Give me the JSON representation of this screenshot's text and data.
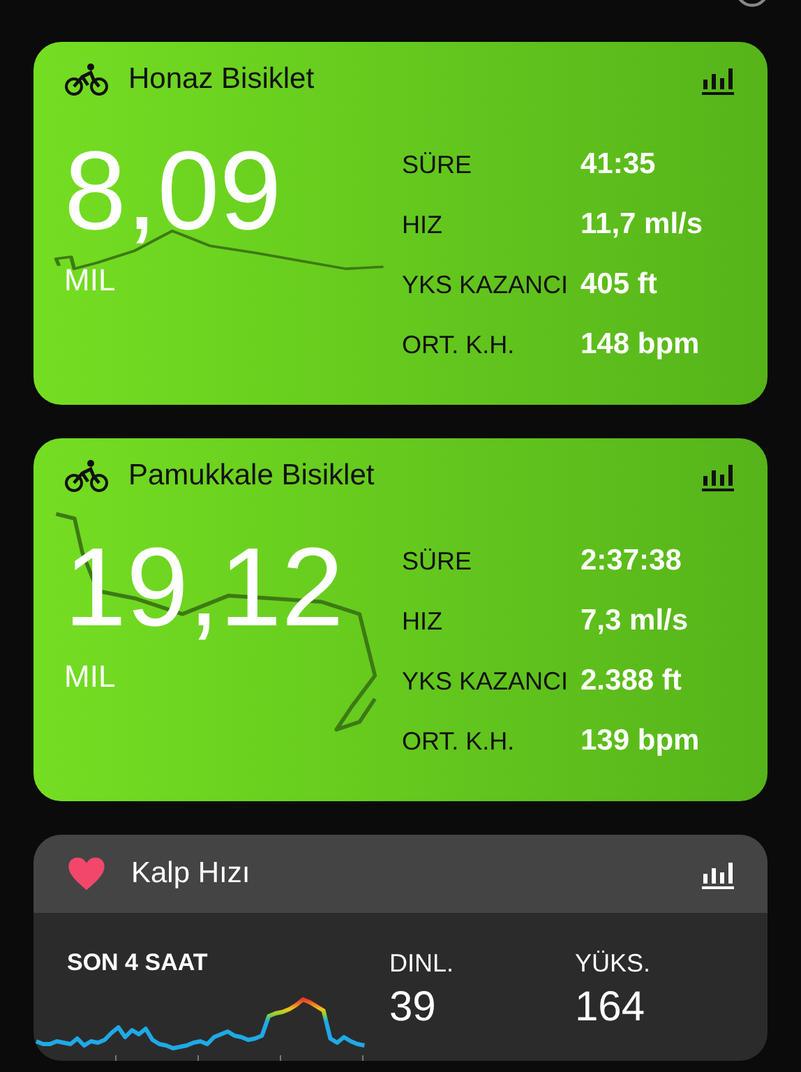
{
  "workouts": [
    {
      "title": "Honaz Bisiklet",
      "distance": "8,09",
      "unit": "MIL",
      "stats": [
        {
          "label": "SÜRE",
          "value": "41:35"
        },
        {
          "label": "HIZ",
          "value": "11,7 ml/s"
        },
        {
          "label": "YKS KAZANCI",
          "value": "405 ft"
        },
        {
          "label": "ORT. K.H.",
          "value": "148 bpm"
        }
      ]
    },
    {
      "title": "Pamukkale Bisiklet",
      "distance": "19,12",
      "unit": "MIL",
      "stats": [
        {
          "label": "SÜRE",
          "value": "2:37:38"
        },
        {
          "label": "HIZ",
          "value": "7,3 ml/s"
        },
        {
          "label": "YKS KAZANCI",
          "value": "2.388 ft"
        },
        {
          "label": "ORT. K.H.",
          "value": "139 bpm"
        }
      ]
    }
  ],
  "heart": {
    "title": "Kalp Hızı",
    "period": "SON 4 SAAT",
    "stats": [
      {
        "label": "DINL.",
        "value": "39"
      },
      {
        "label": "YÜKS.",
        "value": "164"
      }
    ]
  }
}
